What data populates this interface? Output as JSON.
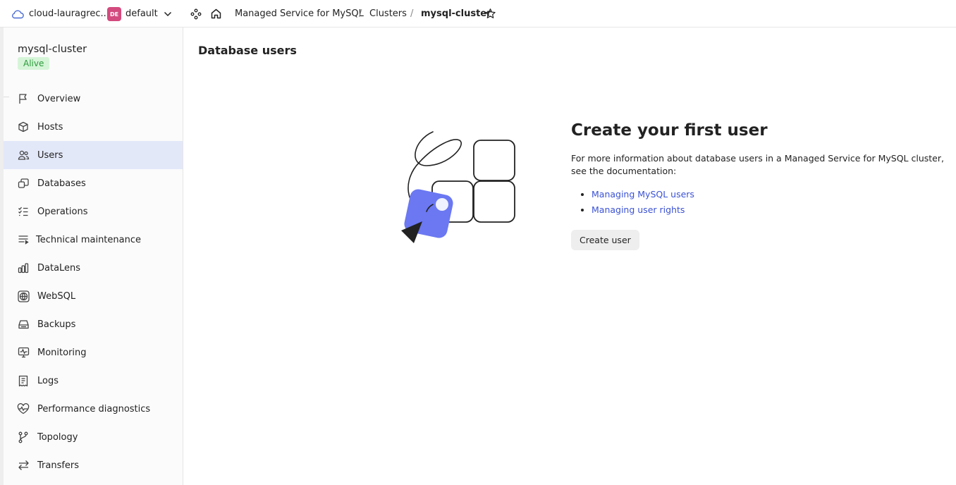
{
  "header": {
    "cloud_name": "cloud-lauragrec...",
    "folder_badge": "DE",
    "folder_name": "default",
    "breadcrumbs": [
      "Managed Service for MySQL",
      "Clusters",
      "mysql-cluster"
    ],
    "separator": "/"
  },
  "sidebar": {
    "cluster_name": "mysql-cluster",
    "status": "Alive",
    "items": [
      {
        "label": "Overview",
        "icon": "flag-icon"
      },
      {
        "label": "Hosts",
        "icon": "cube-icon"
      },
      {
        "label": "Users",
        "icon": "users-icon",
        "active": true
      },
      {
        "label": "Databases",
        "icon": "databases-icon"
      },
      {
        "label": "Operations",
        "icon": "checklist-icon"
      },
      {
        "label": "Technical maintenance",
        "icon": "maintenance-list-icon"
      },
      {
        "label": "DataLens",
        "icon": "bar-chart-icon"
      },
      {
        "label": "WebSQL",
        "icon": "globe-icon"
      },
      {
        "label": "Backups",
        "icon": "drive-icon"
      },
      {
        "label": "Monitoring",
        "icon": "monitor-pulse-icon"
      },
      {
        "label": "Logs",
        "icon": "receipt-icon"
      },
      {
        "label": "Performance diagnostics",
        "icon": "heart-pulse-icon"
      },
      {
        "label": "Topology",
        "icon": "branch-icon"
      },
      {
        "label": "Transfers",
        "icon": "arrows-swap-icon"
      }
    ]
  },
  "main": {
    "title": "Database users",
    "empty_title": "Create your first user",
    "empty_desc": "For more information about database users in a Managed Service for MySQL cluster, see the documentation:",
    "links": [
      "Managing MySQL users",
      "Managing user rights"
    ],
    "create_button": "Create user"
  },
  "colors": {
    "accent": "#3b52d4",
    "active_bg": "#e3e8f9",
    "status_bg": "#d6f5d8",
    "status_text": "#2a9a3a",
    "badge": "#d34a7e",
    "illustration": "#6b78f2"
  }
}
